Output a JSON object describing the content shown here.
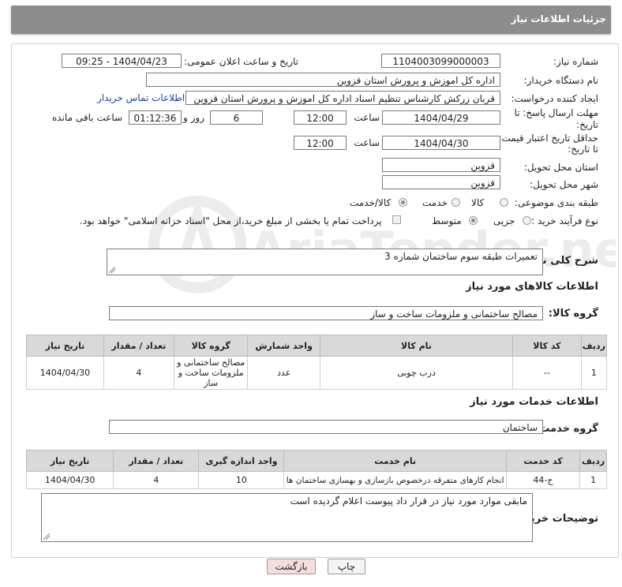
{
  "header": {
    "title": "جزئیات اطلاعات نیاز"
  },
  "form": {
    "need_number_label": "شماره نیاز:",
    "need_number": "1104003099000003",
    "announce_label": "تاریخ و ساعت اعلان عمومی:",
    "announce_value": "1404/04/23 - 09:25",
    "buyer_org_label": "نام دستگاه خریدار:",
    "buyer_org": "اداره کل اموزش و پرورش استان قزوین",
    "creator_label": "ایجاد کننده درخواست:",
    "creator": "قربان زرکش کارشناس تنظیم اسناد اداره کل اموزش و پرورش استان قزوین",
    "contact_link": "اطلاعات تماس خریدار",
    "deadline_label_1": "مهلت ارسال پاسخ: تا",
    "deadline_label_2": "تاریخ:",
    "deadline_date": "1404/04/29",
    "time_label": "ساعت",
    "deadline_time": "12:00",
    "days_value": "6",
    "days_label": "روز و",
    "remaining_value": "01:12:36",
    "remaining_label": "ساعت باقی مانده",
    "validity_label_1": "حداقل تاریخ اعتبار قیمت:",
    "validity_label_2": "تا تاریخ:",
    "validity_date": "1404/04/30",
    "validity_time": "12:00",
    "province_label": "استان محل تحویل:",
    "province": "قزوین",
    "city_label": "شهر محل تحویل:",
    "city": "قزوین",
    "category_label": "طبقه بندی موضوعی:",
    "category_options": [
      "کالا",
      "خدمت",
      "کالا/خدمت"
    ],
    "category_selected": "کالا/خدمت",
    "process_label": "نوع فرآیند خرید :",
    "process_options": [
      "جزیی",
      "متوسط"
    ],
    "process_selected": "متوسط",
    "payment_note": "پرداخت تمام یا بخشی از مبلغ خرید،از محل \"اسناد خزانه اسلامی\" خواهد بود."
  },
  "summary": {
    "label": "شرح کلی نیاز:",
    "value": "تعمیرات طبقه سوم ساختمان شماره 3"
  },
  "goods": {
    "section_title": "اطلاعات کالاهای مورد نیاز",
    "group_label": "گروه کالا:",
    "group_value": "مصالح ساختمانی و ملزومات ساخت و ساز",
    "columns": [
      "ردیف",
      "کد کالا",
      "نام کالا",
      "واحد شمارش",
      "گروه کالا",
      "تعداد / مقدار",
      "تاریخ نیاز"
    ],
    "rows": [
      {
        "row": "1",
        "code": "--",
        "name": "درب چوبی",
        "unit": "عدد",
        "group": "مصالح ساختمانی و ملزومات ساخت و ساز",
        "qty": "4",
        "date": "1404/04/30"
      }
    ]
  },
  "services": {
    "section_title": "اطلاعات خدمات مورد نیاز",
    "group_label": "گروه خدمت:",
    "group_value": "ساختمان",
    "columns": [
      "ردیف",
      "کد خدمت",
      "نام خدمت",
      "واحد اندازه گیری",
      "تعداد / مقدار",
      "تاریخ نیاز"
    ],
    "rows": [
      {
        "row": "1",
        "code": "ج-44",
        "name": "انجام کارهای متفرقه درخصوص بازسازی و بهسازی ساختمان ها",
        "unit": "10",
        "qty": "4",
        "date": "1404/04/30"
      }
    ]
  },
  "buyer_notes": {
    "label": "توضیحات خریدار:",
    "value": "مابقی موارد مورد نیاز در قرار داد پیوست اعلام گردیده است"
  },
  "buttons": {
    "print": "چاپ",
    "back": "بازگشت"
  },
  "watermark": {
    "text": "AriaTender.net"
  },
  "colors": {
    "header_bg": "#8d8d8d",
    "link": "#1a46a8",
    "table_header_bg": "#d9d9d9",
    "back_button_bg": "#f7dede"
  }
}
